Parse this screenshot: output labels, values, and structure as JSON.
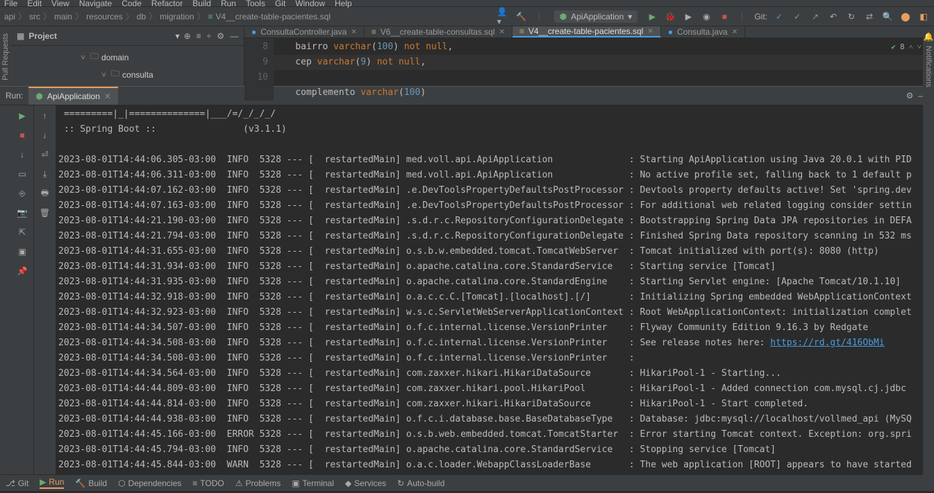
{
  "menu": {
    "items": [
      "File",
      "Edit",
      "View",
      "Navigate",
      "Code",
      "Refactor",
      "Build",
      "Run",
      "Tools",
      "Git",
      "Window",
      "Help"
    ]
  },
  "breadcrumb": {
    "parts": [
      "api",
      "src",
      "main",
      "resources",
      "db",
      "migration"
    ],
    "file": "V4__create-table-pacientes.sql"
  },
  "runConfig": {
    "name": "ApiApplication"
  },
  "gitLabel": "Git:",
  "project": {
    "title": "Project",
    "items": [
      {
        "name": "domain",
        "indent": 1
      },
      {
        "name": "consulta",
        "indent": 2
      }
    ]
  },
  "tabs": {
    "list": [
      {
        "label": "ConsultaController.java",
        "icon": "●",
        "iconColor": "#4a9ce2",
        "active": false
      },
      {
        "label": "V6__create-table-consultas.sql",
        "icon": "≡",
        "iconColor": "#c2a56f",
        "active": false,
        "mod": true
      },
      {
        "label": "V4__create-table-pacientes.sql",
        "icon": "≡",
        "iconColor": "#c2a56f",
        "active": true,
        "mod": true
      },
      {
        "label": "Consulta.java",
        "icon": "●",
        "iconColor": "#4a9ce2",
        "active": false
      }
    ]
  },
  "editor": {
    "status": {
      "warnCount": "8"
    },
    "lines": [
      {
        "num": "8",
        "html": "    bairro <span class='kw-type'>varchar</span>(<span class='kw-num'>100</span>) <span class='kw-type'>not null</span>,"
      },
      {
        "num": "9",
        "html": "    cep <span class='kw-type'>varchar</span>(<span class='kw-num'>9</span>) <span class='kw-type'>not null</span>,",
        "hl": true
      },
      {
        "num": "10",
        "html": "    complemento <span class='kw-type'>varchar</span>(<span class='kw-num'>100</span>)"
      }
    ]
  },
  "run": {
    "label": "Run:",
    "tabName": "ApiApplication",
    "banner1": " =========|_|==============|___/=/_/_/_/",
    "banner2": " :: Spring Boot ::                (v3.1.1)",
    "releaseLink": "https://rd.gt/416ObMi",
    "logs": [
      {
        "ts": "2023-08-01T14:44:06.305-03:00",
        "lvl": "INFO",
        "pid": "5328",
        "thread": "restartedMain",
        "logger": "med.voll.api.ApiApplication",
        "msg": "Starting ApiApplication using Java 20.0.1 with PID"
      },
      {
        "ts": "2023-08-01T14:44:06.311-03:00",
        "lvl": "INFO",
        "pid": "5328",
        "thread": "restartedMain",
        "logger": "med.voll.api.ApiApplication",
        "msg": "No active profile set, falling back to 1 default p"
      },
      {
        "ts": "2023-08-01T14:44:07.162-03:00",
        "lvl": "INFO",
        "pid": "5328",
        "thread": "restartedMain",
        "logger": ".e.DevToolsPropertyDefaultsPostProcessor",
        "msg": "Devtools property defaults active! Set 'spring.dev"
      },
      {
        "ts": "2023-08-01T14:44:07.163-03:00",
        "lvl": "INFO",
        "pid": "5328",
        "thread": "restartedMain",
        "logger": ".e.DevToolsPropertyDefaultsPostProcessor",
        "msg": "For additional web related logging consider settin"
      },
      {
        "ts": "2023-08-01T14:44:21.190-03:00",
        "lvl": "INFO",
        "pid": "5328",
        "thread": "restartedMain",
        "logger": ".s.d.r.c.RepositoryConfigurationDelegate",
        "msg": "Bootstrapping Spring Data JPA repositories in DEFA"
      },
      {
        "ts": "2023-08-01T14:44:21.794-03:00",
        "lvl": "INFO",
        "pid": "5328",
        "thread": "restartedMain",
        "logger": ".s.d.r.c.RepositoryConfigurationDelegate",
        "msg": "Finished Spring Data repository scanning in 532 ms"
      },
      {
        "ts": "2023-08-01T14:44:31.655-03:00",
        "lvl": "INFO",
        "pid": "5328",
        "thread": "restartedMain",
        "logger": "o.s.b.w.embedded.tomcat.TomcatWebServer",
        "msg": "Tomcat initialized with port(s): 8080 (http)"
      },
      {
        "ts": "2023-08-01T14:44:31.934-03:00",
        "lvl": "INFO",
        "pid": "5328",
        "thread": "restartedMain",
        "logger": "o.apache.catalina.core.StandardService",
        "msg": "Starting service [Tomcat]"
      },
      {
        "ts": "2023-08-01T14:44:31.935-03:00",
        "lvl": "INFO",
        "pid": "5328",
        "thread": "restartedMain",
        "logger": "o.apache.catalina.core.StandardEngine",
        "msg": "Starting Servlet engine: [Apache Tomcat/10.1.10]"
      },
      {
        "ts": "2023-08-01T14:44:32.918-03:00",
        "lvl": "INFO",
        "pid": "5328",
        "thread": "restartedMain",
        "logger": "o.a.c.c.C.[Tomcat].[localhost].[/]",
        "msg": "Initializing Spring embedded WebApplicationContext"
      },
      {
        "ts": "2023-08-01T14:44:32.923-03:00",
        "lvl": "INFO",
        "pid": "5328",
        "thread": "restartedMain",
        "logger": "w.s.c.ServletWebServerApplicationContext",
        "msg": "Root WebApplicationContext: initialization complet"
      },
      {
        "ts": "2023-08-01T14:44:34.507-03:00",
        "lvl": "INFO",
        "pid": "5328",
        "thread": "restartedMain",
        "logger": "o.f.c.internal.license.VersionPrinter",
        "msg": "Flyway Community Edition 9.16.3 by Redgate"
      },
      {
        "ts": "2023-08-01T14:44:34.508-03:00",
        "lvl": "INFO",
        "pid": "5328",
        "thread": "restartedMain",
        "logger": "o.f.c.internal.license.VersionPrinter",
        "msg": "See release notes here: ",
        "link": true
      },
      {
        "ts": "2023-08-01T14:44:34.508-03:00",
        "lvl": "INFO",
        "pid": "5328",
        "thread": "restartedMain",
        "logger": "o.f.c.internal.license.VersionPrinter",
        "msg": ""
      },
      {
        "ts": "2023-08-01T14:44:34.564-03:00",
        "lvl": "INFO",
        "pid": "5328",
        "thread": "restartedMain",
        "logger": "com.zaxxer.hikari.HikariDataSource",
        "msg": "HikariPool-1 - Starting..."
      },
      {
        "ts": "2023-08-01T14:44:44.809-03:00",
        "lvl": "INFO",
        "pid": "5328",
        "thread": "restartedMain",
        "logger": "com.zaxxer.hikari.pool.HikariPool",
        "msg": "HikariPool-1 - Added connection com.mysql.cj.jdbc"
      },
      {
        "ts": "2023-08-01T14:44:44.814-03:00",
        "lvl": "INFO",
        "pid": "5328",
        "thread": "restartedMain",
        "logger": "com.zaxxer.hikari.HikariDataSource",
        "msg": "HikariPool-1 - Start completed."
      },
      {
        "ts": "2023-08-01T14:44:44.938-03:00",
        "lvl": "INFO",
        "pid": "5328",
        "thread": "restartedMain",
        "logger": "o.f.c.i.database.base.BaseDatabaseType",
        "msg": "Database: jdbc:mysql://localhost/vollmed_api (MySQ"
      },
      {
        "ts": "2023-08-01T14:44:45.166-03:00",
        "lvl": "ERROR",
        "pid": "5328",
        "thread": "restartedMain",
        "logger": "o.s.b.web.embedded.tomcat.TomcatStarter",
        "msg": "Error starting Tomcat context. Exception: org.spri"
      },
      {
        "ts": "2023-08-01T14:44:45.794-03:00",
        "lvl": "INFO",
        "pid": "5328",
        "thread": "restartedMain",
        "logger": "o.apache.catalina.core.StandardService",
        "msg": "Stopping service [Tomcat]"
      },
      {
        "ts": "2023-08-01T14:44:45.844-03:00",
        "lvl": "WARN",
        "pid": "5328",
        "thread": "restartedMain",
        "logger": "o.a.c.loader.WebappClassLoaderBase",
        "msg": "The web application [ROOT] appears to have started"
      }
    ]
  },
  "statusbar": {
    "items": [
      "Git",
      "Run",
      "Build",
      "Dependencies",
      "TODO",
      "Problems",
      "Terminal",
      "Services",
      "Auto-build"
    ]
  }
}
